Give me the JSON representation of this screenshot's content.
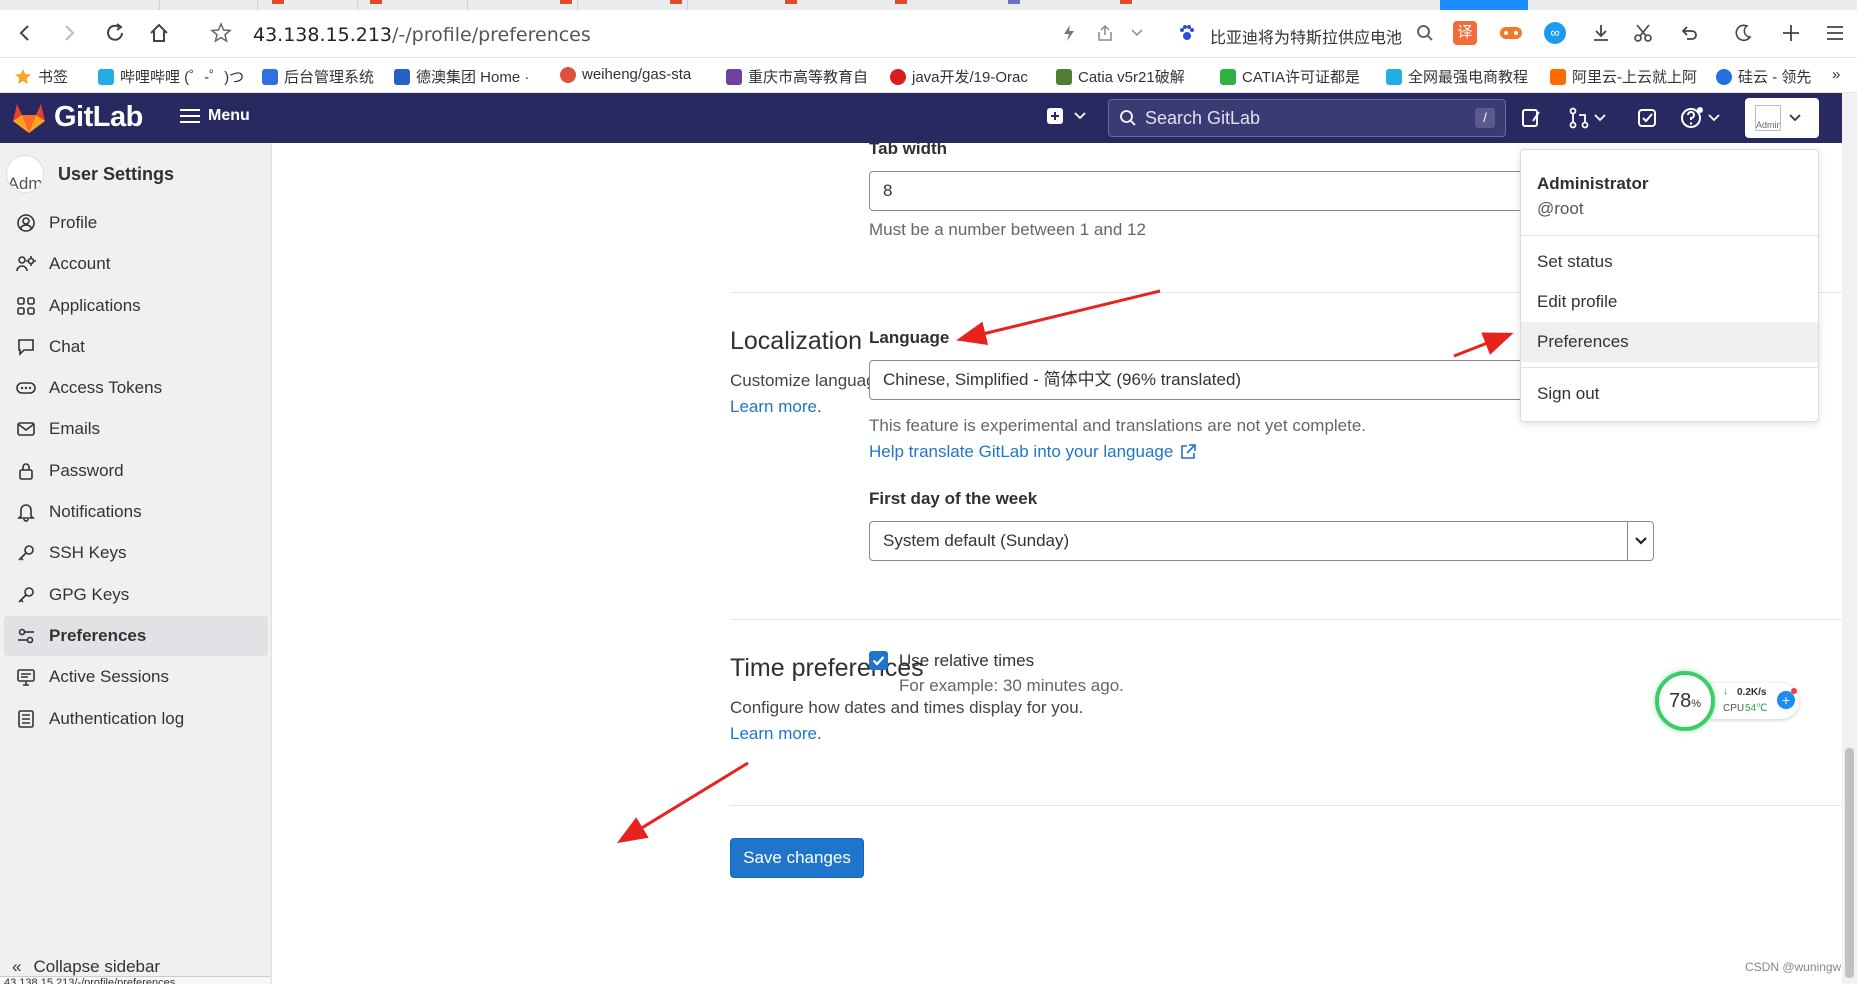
{
  "browser": {
    "url_host": "43.138.15.213",
    "url_path": "/-/profile/preferences",
    "news_text": "比亚迪将为特斯拉供应电池",
    "bookmarks": [
      {
        "label": "书签",
        "color": "#f5a623"
      },
      {
        "label": "哔哩哔哩 (゜-゜)つ",
        "color": "#23ade5"
      },
      {
        "label": "后台管理系统",
        "color": "#3070e0"
      },
      {
        "label": "德澳集团 Home ·",
        "color": "#2660c8"
      },
      {
        "label": "weiheng/gas-sta",
        "color": "#e05040"
      },
      {
        "label": "重庆市高等教育自",
        "color": "#7040a0"
      },
      {
        "label": "java开发/19-Orac",
        "color": "#d42020"
      },
      {
        "label": "Catia v5r21破解",
        "color": "#508030"
      },
      {
        "label": "CATIA许可证都是",
        "color": "#30b040"
      },
      {
        "label": "全网最强电商教程",
        "color": "#23ade5"
      },
      {
        "label": "阿里云-上云就上阿",
        "color": "#ff6a00"
      },
      {
        "label": "硅云 - 领先",
        "color": "#2070e0"
      }
    ]
  },
  "header": {
    "logo_text": "GitLab",
    "menu_label": "Menu",
    "search_placeholder": "Search GitLab",
    "search_shortcut": "/",
    "avatar_alt": "Administ"
  },
  "sidebar": {
    "avatar_alt": "Adm",
    "title": "User Settings",
    "items": [
      {
        "label": "Profile",
        "icon": "profile-icon"
      },
      {
        "label": "Account",
        "icon": "account-icon"
      },
      {
        "label": "Applications",
        "icon": "applications-icon"
      },
      {
        "label": "Chat",
        "icon": "chat-icon"
      },
      {
        "label": "Access Tokens",
        "icon": "token-icon"
      },
      {
        "label": "Emails",
        "icon": "mail-icon"
      },
      {
        "label": "Password",
        "icon": "lock-icon"
      },
      {
        "label": "Notifications",
        "icon": "bell-icon"
      },
      {
        "label": "SSH Keys",
        "icon": "key-icon"
      },
      {
        "label": "GPG Keys",
        "icon": "key-icon"
      },
      {
        "label": "Preferences",
        "icon": "preferences-icon",
        "active": true
      },
      {
        "label": "Active Sessions",
        "icon": "monitor-icon"
      },
      {
        "label": "Authentication log",
        "icon": "log-icon"
      }
    ],
    "collapse_label": "Collapse sidebar",
    "status_url": "43.138.15.213/-/profile/preferences"
  },
  "tab_width": {
    "label": "Tab width",
    "value": "8",
    "help": "Must be a number between 1 and 12"
  },
  "localization": {
    "title": "Localization",
    "description": "Customize language and region related settings.",
    "learn_more": "Learn more",
    "language_label": "Language",
    "language_value": "Chinese, Simplified - 简体中文 (96% translated)",
    "experimental_note": "This feature is experimental and translations are not yet complete.",
    "translate_link": "Help translate GitLab into your language",
    "first_day_label": "First day of the week",
    "first_day_value": "System default (Sunday)"
  },
  "time_preferences": {
    "title": "Time preferences",
    "description": "Configure how dates and times display for you.",
    "learn_more": "Learn more",
    "relative_label": "Use relative times",
    "relative_checked": true,
    "relative_example": "For example: 30 minutes ago."
  },
  "save_label": "Save changes",
  "user_dropdown": {
    "name": "Administrator",
    "username": "@root",
    "items": [
      "Set status",
      "Edit profile",
      "Preferences",
      "Sign out"
    ]
  },
  "cpu_widget": {
    "percent": "78",
    "percent_unit": "%",
    "speed": "0.2K/s",
    "cpu_label": "CPU",
    "cpu_temp": "54℃"
  },
  "watermark": "CSDN @wuningw",
  "colors": {
    "header_bg": "#292961",
    "accent_blue": "#1f75cb",
    "arrow_red": "#e8231f"
  }
}
